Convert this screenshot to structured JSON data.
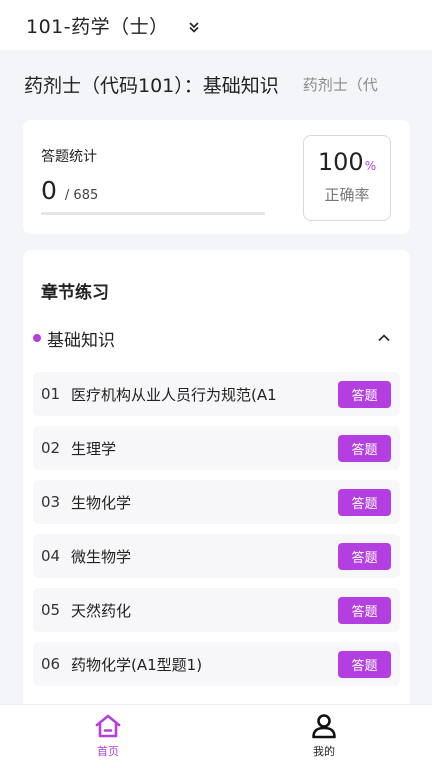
{
  "header": {
    "title": "101-药学（士）",
    "dropdown_icon": "double-chevron-down-icon"
  },
  "subject": {
    "main": "药剂士（代码101）：基础知识",
    "secondary": "药剂士（代"
  },
  "stats": {
    "label": "答题统计",
    "answered": "0",
    "total": "/ 685",
    "progress_fraction": 0,
    "accuracy_value": "100",
    "accuracy_unit": "%",
    "accuracy_label": "正确率"
  },
  "chapters": {
    "heading": "章节练习",
    "group_name": "基础知识",
    "collapse_icon": "chevron-up-icon",
    "button_label": "答题",
    "items": [
      {
        "index": "01",
        "name": "医疗机构从业人员行为规范(A1"
      },
      {
        "index": "02",
        "name": "生理学"
      },
      {
        "index": "03",
        "name": "生物化学"
      },
      {
        "index": "04",
        "name": "微生物学"
      },
      {
        "index": "05",
        "name": "天然药化"
      },
      {
        "index": "06",
        "name": "药物化学(A1型题1)"
      }
    ]
  },
  "nav": {
    "home_label": "首页",
    "home_icon": "home-icon",
    "mine_label": "我的",
    "mine_icon": "user-icon"
  },
  "colors": {
    "accent": "#b43fe0",
    "background": "#f4f5f9"
  }
}
